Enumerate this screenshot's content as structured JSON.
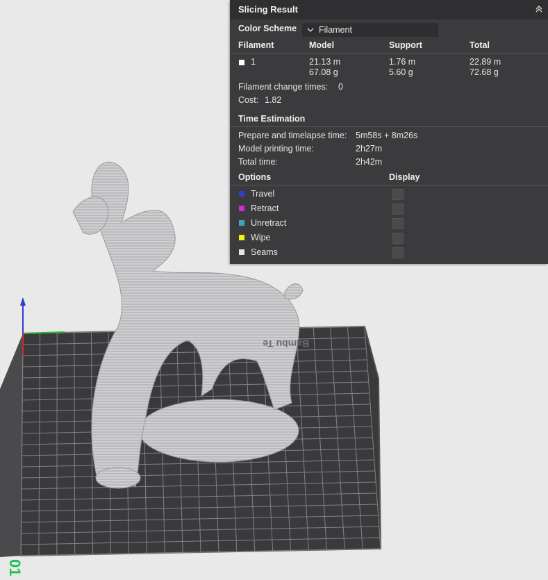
{
  "panel": {
    "title": "Slicing Result",
    "color_scheme_label": "Color Scheme",
    "color_scheme_value": "Filament",
    "table": {
      "headers": [
        "Filament",
        "Model",
        "Support",
        "Total"
      ],
      "row": {
        "filament": "1",
        "model_length": "21.13 m",
        "model_weight": "67.08 g",
        "support_length": "1.76 m",
        "support_weight": "5.60 g",
        "total_length": "22.89 m",
        "total_weight": "72.68 g"
      }
    },
    "filament_change_label": "Filament change times:",
    "filament_change_value": "0",
    "cost_label": "Cost:",
    "cost_value": "1.82",
    "time_title": "Time Estimation",
    "prepare_label": "Prepare and timelapse time:",
    "prepare_value": "5m58s + 8m26s",
    "model_time_label": "Model printing time:",
    "model_time_value": "2h27m",
    "total_time_label": "Total time:",
    "total_time_value": "2h42m",
    "options_header": "Options",
    "display_header": "Display",
    "options": [
      {
        "label": "Travel",
        "color": "#3b3bc9"
      },
      {
        "label": "Retract",
        "color": "#d12bd1"
      },
      {
        "label": "Unretract",
        "color": "#3aa6c2"
      },
      {
        "label": "Wipe",
        "color": "#f2f20b"
      },
      {
        "label": "Seams",
        "color": "#e6e6e6"
      }
    ]
  },
  "plate": {
    "brand_text": "Bambu Te",
    "plate_number": "01"
  }
}
